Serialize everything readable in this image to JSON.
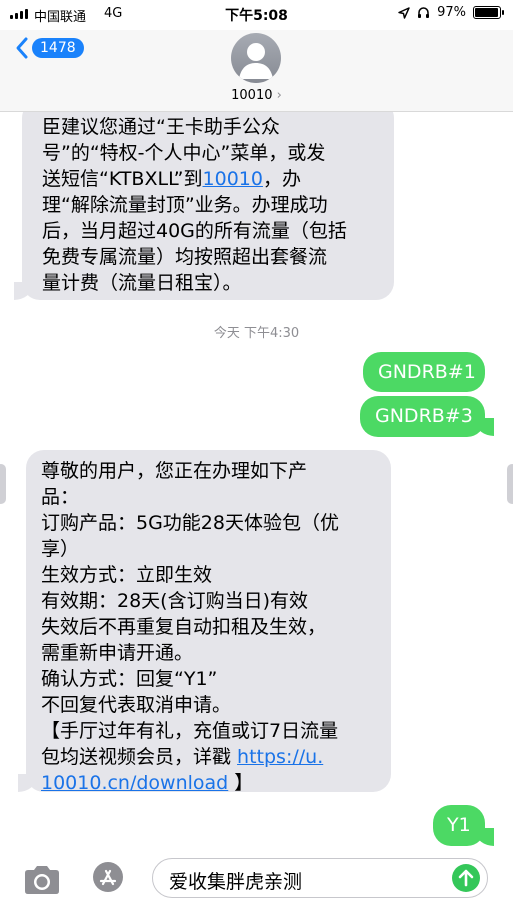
{
  "status_bar": {
    "carrier": "中国联通",
    "network": "4G",
    "time": "下午5:08",
    "battery_percent": "97%",
    "battery_level": 0.97
  },
  "header": {
    "back_badge": "1478",
    "contact_name": "10010",
    "contact_chevron": "›"
  },
  "messages": {
    "msg1_lines": [
      "臣建议您通过“王卡助手公众",
      "号”的“特权-个人中心”菜单，或发",
      "送短信“KTBXLL”到",
      "10010",
      "，办",
      "理“解除流量封顶”业务。办理成功",
      "后，当月超过40G的所有流量（包括",
      "免费专属流量）均按照超出套餐流",
      "量计费（流量日租宝）。"
    ],
    "timestamp": "今天 下午4:30",
    "sent1": "GNDRB#1",
    "sent2": "GNDRB#3",
    "msg2_lines": [
      "尊敬的用户，您正在办理如下产",
      "品：",
      " 订购产品：5G功能28天体验包（优",
      "享）",
      " 生效方式：立即生效",
      " 有效期：28天(含订购当日)有效",
      " 失效后不再重复自动扣租及生效，",
      "需重新申请开通。",
      " 确认方式：回复“Y1”",
      " 不回复代表取消申请。",
      "【手厅过年有礼，充值或订7日流量",
      "包均送视频会员，详戳 ",
      "https://u.",
      "10010.cn/download",
      " 】"
    ],
    "sent3": "Y1"
  },
  "input_bar": {
    "draft_text": "爱收集胖虎亲测"
  },
  "icons": {
    "signal": "signal-bars-icon",
    "location": "location-arrow-icon",
    "headphones": "headphones-icon",
    "battery": "battery-icon",
    "back": "chevron-left-icon",
    "avatar": "person-silhouette-icon",
    "camera": "camera-icon",
    "appstore": "app-store-icon",
    "send": "send-arrow-icon"
  },
  "colors": {
    "sent_bubble": "#4cd964",
    "received_bubble": "#e5e5ea",
    "link": "#1a73e8",
    "accent": "#1a82fb"
  }
}
